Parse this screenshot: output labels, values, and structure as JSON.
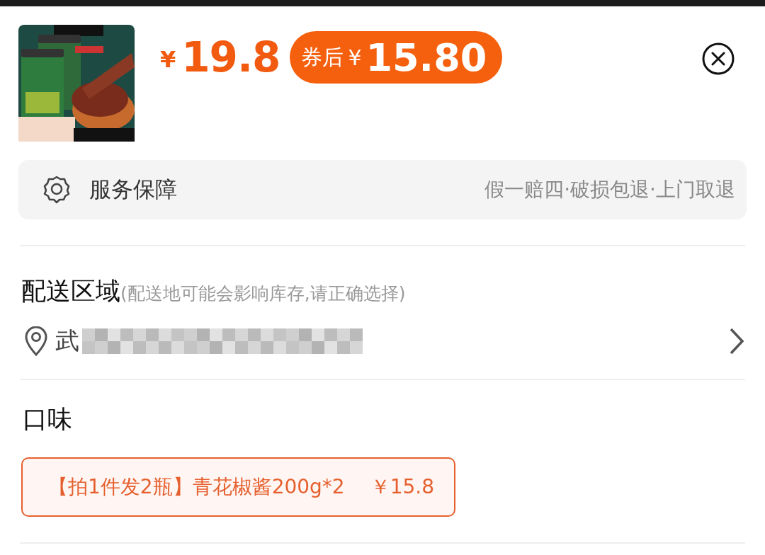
{
  "product": {
    "currency": "¥",
    "price": "19.8",
    "coupon_badge": {
      "label": "券后",
      "currency": "¥",
      "amount": "15.80"
    }
  },
  "service": {
    "title": "服务保障",
    "features": "假一赔四·破损包退·上门取退"
  },
  "delivery": {
    "title": "配送区域",
    "hint": "(配送地可能会影响库存,请正确选择)",
    "address": "武"
  },
  "flavor": {
    "title": "口味",
    "options": [
      {
        "label": "【拍1件发2瓶】青花椒酱200g*2",
        "price": "￥15.8",
        "selected": true
      }
    ]
  }
}
